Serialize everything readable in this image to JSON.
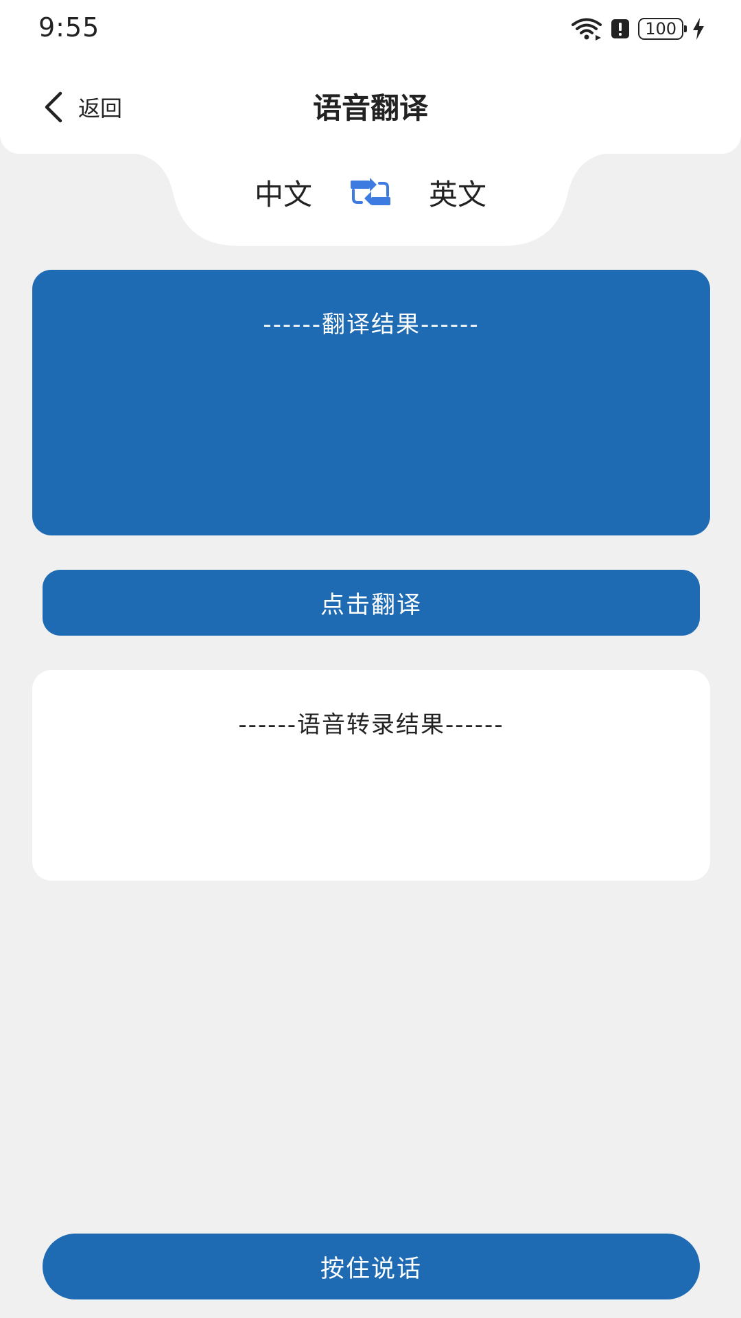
{
  "status_bar": {
    "time": "9:55",
    "battery_level": "100",
    "icons": [
      "wifi-icon",
      "alert-icon",
      "battery-icon",
      "charging-icon"
    ]
  },
  "header": {
    "back_label": "返回",
    "title": "语音翻译"
  },
  "language_switch": {
    "source": "中文",
    "target": "英文",
    "swap_icon": "swap-icon"
  },
  "translation_result": {
    "title": "------翻译结果------",
    "text": ""
  },
  "translate_button": {
    "label": "点击翻译"
  },
  "transcription_result": {
    "title": "------语音转录结果------",
    "text": ""
  },
  "speak_button": {
    "label": "按住说话"
  },
  "colors": {
    "primary": "#1f6bb3",
    "swap_icon": "#3d7be0",
    "background": "#f0f0f0",
    "surface": "#ffffff",
    "text": "#222222"
  }
}
